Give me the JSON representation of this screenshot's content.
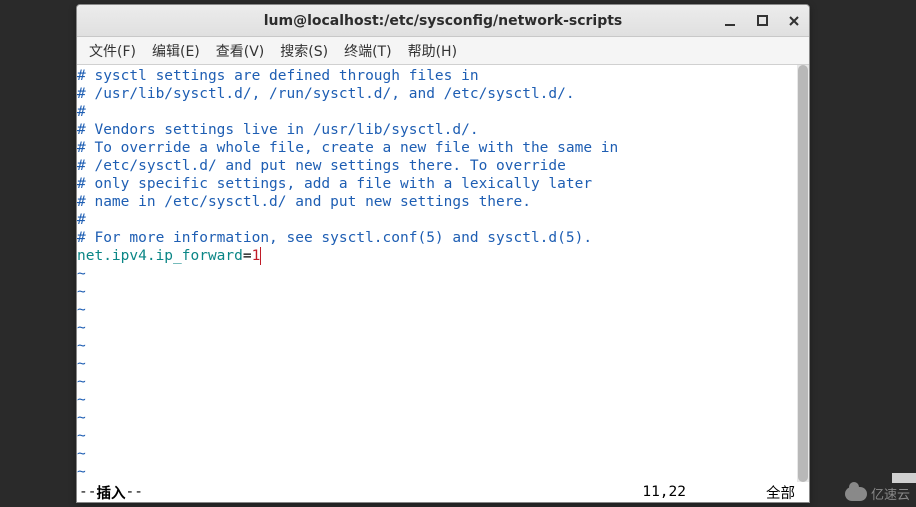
{
  "window": {
    "title": "lum@localhost:/etc/sysconfig/network-scripts"
  },
  "menu": {
    "file": "文件(F)",
    "edit": "编辑(E)",
    "view": "查看(V)",
    "search": "搜索(S)",
    "terminal": "终端(T)",
    "help": "帮助(H)"
  },
  "editor": {
    "comments": [
      "# sysctl settings are defined through files in",
      "# /usr/lib/sysctl.d/, /run/sysctl.d/, and /etc/sysctl.d/.",
      "#",
      "# Vendors settings live in /usr/lib/sysctl.d/.",
      "# To override a whole file, create a new file with the same in",
      "# /etc/sysctl.d/ and put new settings there. To override",
      "# only specific settings, add a file with a lexically later",
      "# name in /etc/sysctl.d/ and put new settings there.",
      "#",
      "# For more information, see sysctl.conf(5) and sysctl.d(5)."
    ],
    "setting_key": "net.ipv4.ip_forward",
    "setting_op": "=",
    "setting_val": "1",
    "tilde": "~"
  },
  "status": {
    "mode_prefix": "-- ",
    "mode": "插入",
    "mode_suffix": " --",
    "position": "11,22",
    "percent": "全部"
  },
  "watermark": {
    "text": "亿速云"
  }
}
